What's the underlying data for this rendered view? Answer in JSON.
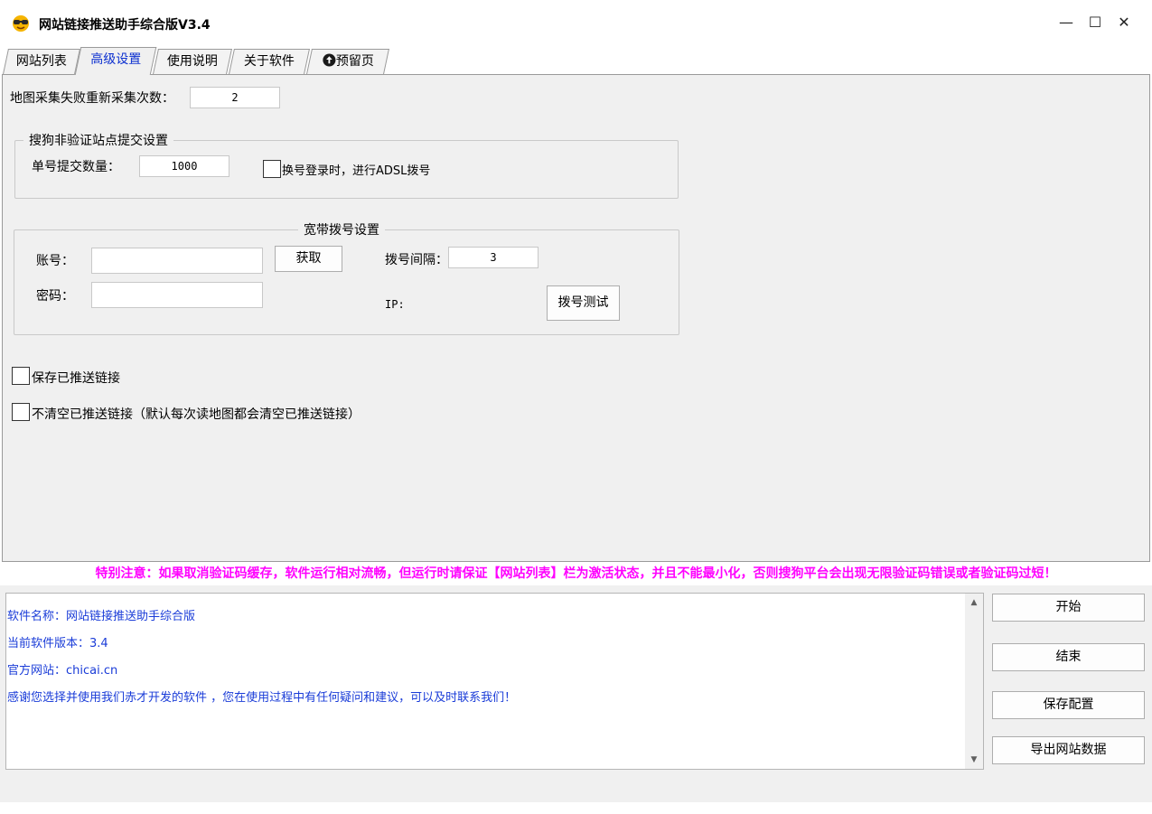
{
  "window": {
    "title": "网站链接推送助手综合版V3.4",
    "controls": {
      "minimize": "—",
      "maximize": "☐",
      "close": "✕"
    }
  },
  "tabs": [
    {
      "label": "网站列表",
      "active": false
    },
    {
      "label": "高级设置",
      "active": true
    },
    {
      "label": "使用说明",
      "active": false
    },
    {
      "label": "关于软件",
      "active": false
    },
    {
      "label": "预留页",
      "active": false,
      "icon": "arrow-up-circle-icon"
    }
  ],
  "advanced": {
    "sitemap_retry_label": "地图采集失败重新采集次数：",
    "sitemap_retry_value": "2",
    "sogou_group": {
      "title": "搜狗非验证站点提交设置",
      "per_account_label": "单号提交数量：",
      "per_account_value": "1000",
      "adsl_on_switch_label": "换号登录时，进行ADSL拨号",
      "adsl_on_switch_checked": false
    },
    "broadband_group": {
      "title": "宽带拨号设置",
      "account_label": "账号：",
      "account_value": "",
      "password_label": "密码：",
      "password_value": "",
      "fetch_button": "获取",
      "interval_label": "拨号间隔：",
      "interval_value": "3",
      "ip_label": "IP:",
      "test_button": "拨号测试"
    },
    "save_pushed_label": "保存已推送链接",
    "save_pushed_checked": false,
    "no_clear_label": "不清空已推送链接（默认每次读地图都会清空已推送链接）",
    "no_clear_checked": false
  },
  "notice": "特别注意：如果取消验证码缓存，软件运行相对流畅，但运行时请保证【网站列表】栏为激活状态，并且不能最小化，否则搜狗平台会出现无限验证码错误或者验证码过短！",
  "log": [
    "软件名称：网站链接推送助手综合版",
    "当前软件版本：3.4",
    "官方网站：chicai.cn",
    "感谢您选择并使用我们赤才开发的软件 ，您在使用过程中有任何疑问和建议，可以及时联系我们！"
  ],
  "actions": {
    "start": "开始",
    "stop": "结束",
    "save_config": "保存配置",
    "export": "导出网站数据"
  },
  "colors": {
    "notice": "#ff00ff",
    "log_text": "#1a3cd8",
    "active_tab_text": "#0b2fd0",
    "panel_bg": "#f0f0f0"
  }
}
